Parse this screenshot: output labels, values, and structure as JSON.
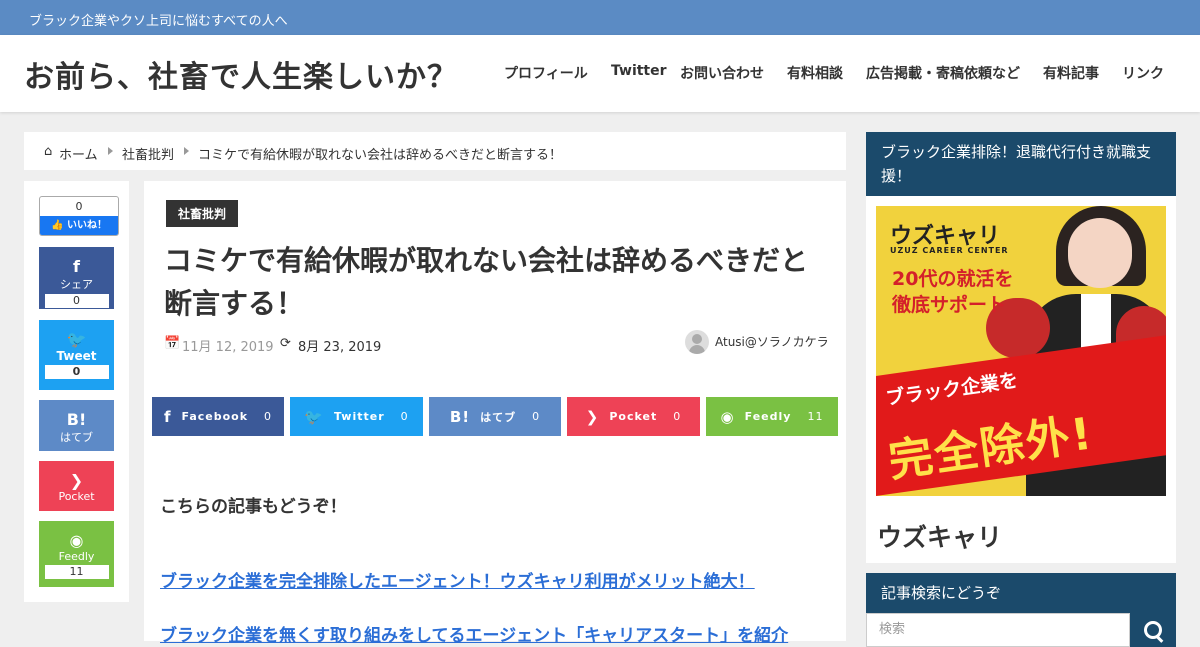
{
  "topbar": {
    "tagline": "ブラック企業やクソ上司に悩むすべての人へ"
  },
  "header": {
    "site_title": "お前ら、社畜で人生楽しいか？",
    "nav": [
      "プロフィール",
      "Twitter",
      "お問い合わせ",
      "有料相談",
      "広告掲載・寄稿依頼など",
      "有料記事",
      "リンク"
    ]
  },
  "breadcrumb": {
    "home": "ホーム",
    "category": "社畜批判",
    "current": "コミケで有給休暇が取れない会社は辞めるべきだと断言する！"
  },
  "share_vertical": {
    "like_count": "0",
    "like_label": "いいね！",
    "facebook": {
      "label": "シェア",
      "count": "0",
      "icon": "f"
    },
    "twitter": {
      "label": "Tweet",
      "count": "0",
      "icon": "🐦"
    },
    "hatena": {
      "label": "はてブ",
      "icon": "B!"
    },
    "pocket": {
      "label": "Pocket",
      "icon": "❯"
    },
    "feedly": {
      "label": "Feedly",
      "count": "11",
      "icon": "◉"
    }
  },
  "article": {
    "category": "社畜批判",
    "title": "コミケで有給休暇が取れない会社は辞めるべきだと断言する！",
    "published": "11月 12, 2019",
    "updated": "8月 23, 2019",
    "author": "Atusi@ソラノカケラ",
    "more_heading": "こちらの記事もどうぞ！",
    "links": [
      "ブラック企業を完全排除したエージェント！ウズキャリ利用がメリット絶大！",
      "ブラック企業を無くす取り組みをしてるエージェント「キャリアスタート」を紹介"
    ]
  },
  "share_horizontal": [
    {
      "label": "Facebook",
      "count": "0",
      "icon": "f",
      "color": "#3b5998"
    },
    {
      "label": "Twitter",
      "count": "0",
      "icon": "🐦",
      "color": "#1da1f2"
    },
    {
      "label": "はてブ",
      "count": "0",
      "icon": "B!",
      "color": "#5d8ac7"
    },
    {
      "label": "Pocket",
      "count": "0",
      "icon": "❯",
      "color": "#ee4256"
    },
    {
      "label": "Feedly",
      "count": "11",
      "icon": "◉",
      "color": "#7ac143"
    }
  ],
  "sidebar": {
    "widget1": {
      "title": "ブラック企業排除！退職代行付き就職支援！",
      "banner": {
        "brand": "ウズキャリ",
        "brand_sub": "UZUZ CAREER CENTER",
        "headline1": "20代の就活を",
        "headline2": "徹底サポート",
        "bottom1": "ブラック企業を",
        "bottom2": "完全除外!"
      },
      "name": "ウズキャリ"
    },
    "widget2": {
      "title": "記事検索にどうぞ",
      "placeholder": "検索"
    }
  },
  "colors": {
    "topbar": "#5b8bc4",
    "widget_title": "#1b4a6b",
    "link": "#2b6ed6",
    "facebook": "#3b5998",
    "twitter": "#1da1f2",
    "hatena": "#5d8ac7",
    "pocket": "#ee4256",
    "feedly": "#7ac143"
  }
}
